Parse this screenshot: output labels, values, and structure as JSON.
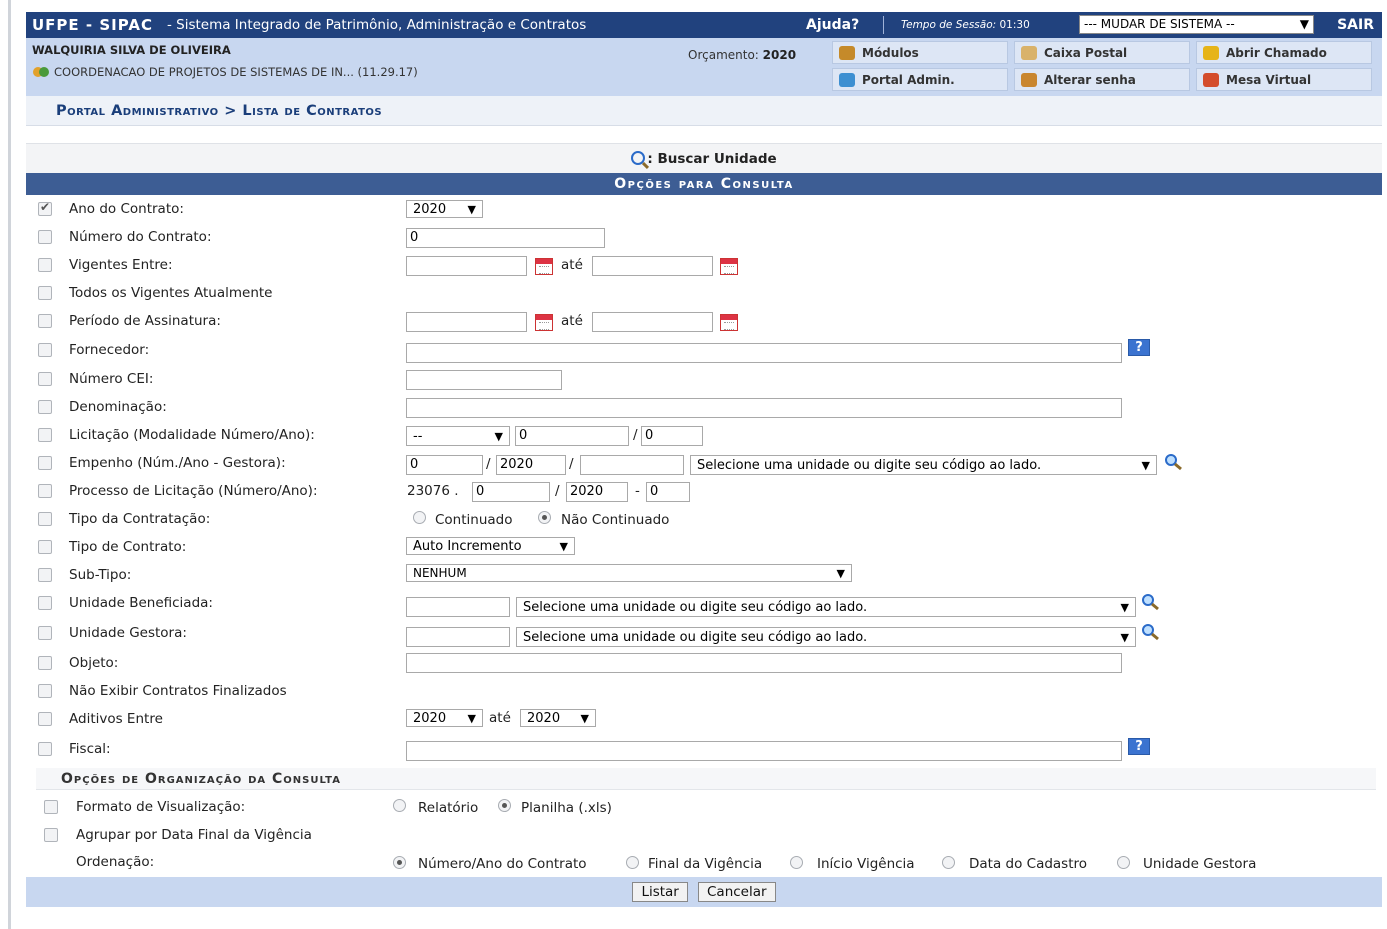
{
  "topbar": {
    "title": "UFPE - SIPAC",
    "subtitle": "- Sistema Integrado de Patrimônio, Administração e Contratos",
    "help": "Ajuda?",
    "session_label": "Tempo de Sessão:",
    "session_time": "01:30",
    "system_select": "--- MUDAR DE SISTEMA --",
    "exit": "SAIR"
  },
  "user": {
    "name": "WALQUIRIA SILVA DE OLIVEIRA",
    "unit": "COORDENACAO DE PROJETOS DE SISTEMAS DE IN... (11.29.17)",
    "budget_label": "Orçamento:",
    "budget_year": "2020"
  },
  "quick_links": {
    "modules": "Módulos",
    "mailbox": "Caixa Postal",
    "ticket": "Abrir Chamado",
    "admin_portal": "Portal Admin.",
    "change_password": "Alterar senha",
    "virtual_desk": "Mesa Virtual"
  },
  "breadcrumb": "Portal Administrativo > Lista de Contratos",
  "search_unit": ": Buscar Unidade",
  "section_title": "Opções para Consulta",
  "labels": {
    "ano": "Ano do Contrato:",
    "numero": "Número do Contrato:",
    "vigentes": "Vigentes Entre:",
    "todos": "Todos os Vigentes Atualmente",
    "periodo": "Período de Assinatura:",
    "fornecedor": "Fornecedor:",
    "cei": "Número CEI:",
    "denominacao": "Denominação:",
    "licitacao": "Licitação (Modalidade Número/Ano):",
    "empenho": "Empenho (Núm./Ano - Gestora):",
    "processo": "Processo de Licitação (Número/Ano):",
    "tipo_contratacao": "Tipo da Contratação:",
    "tipo_contrato": "Tipo de Contrato:",
    "subtipo": "Sub-Tipo:",
    "beneficiada": "Unidade Beneficiada:",
    "gestora": "Unidade Gestora:",
    "objeto": "Objeto:",
    "nao_exibir": "Não Exibir Contratos Finalizados",
    "aditivos": "Aditivos Entre",
    "fiscal": "Fiscal:"
  },
  "values": {
    "ano": "2020",
    "numero": "0",
    "ate": "até",
    "licitacao_modalidade": "--",
    "licitacao_numero": "0",
    "licitacao_ano": "0",
    "slash": "/",
    "empenho_num": "0",
    "empenho_ano": "2020",
    "unit_select_placeholder": "Selecione uma unidade ou digite seu código ao lado.",
    "processo_prefix": "23076 .",
    "processo_num": "0",
    "processo_ano": "2020",
    "dash": "-",
    "processo_dv": "0",
    "continuado": "Continuado",
    "nao_continuado": "Não Continuado",
    "tipo_contrato": "Auto Incremento",
    "subtipo": "NENHUM",
    "aditivos_de": "2020",
    "aditivos_ate": "2020"
  },
  "org_section_title": "Opções de Organização da Consulta",
  "org": {
    "formato_label": "Formato de Visualização:",
    "relatorio": "Relatório",
    "planilha": "Planilha (.xls)",
    "agrupar_label": "Agrupar por Data Final da Vigência",
    "ordenacao_label": "Ordenação:",
    "ord_numero": "Número/Ano do Contrato",
    "ord_final": "Final da Vigência",
    "ord_inicio": "Início Vigência",
    "ord_cadastro": "Data do Cadastro",
    "ord_gestora": "Unidade Gestora"
  },
  "buttons": {
    "listar": "Listar",
    "cancelar": "Cancelar"
  },
  "colors": {
    "topbar": "#21427e",
    "info_band": "#c8d7f0",
    "section_header": "#3d5d94"
  }
}
